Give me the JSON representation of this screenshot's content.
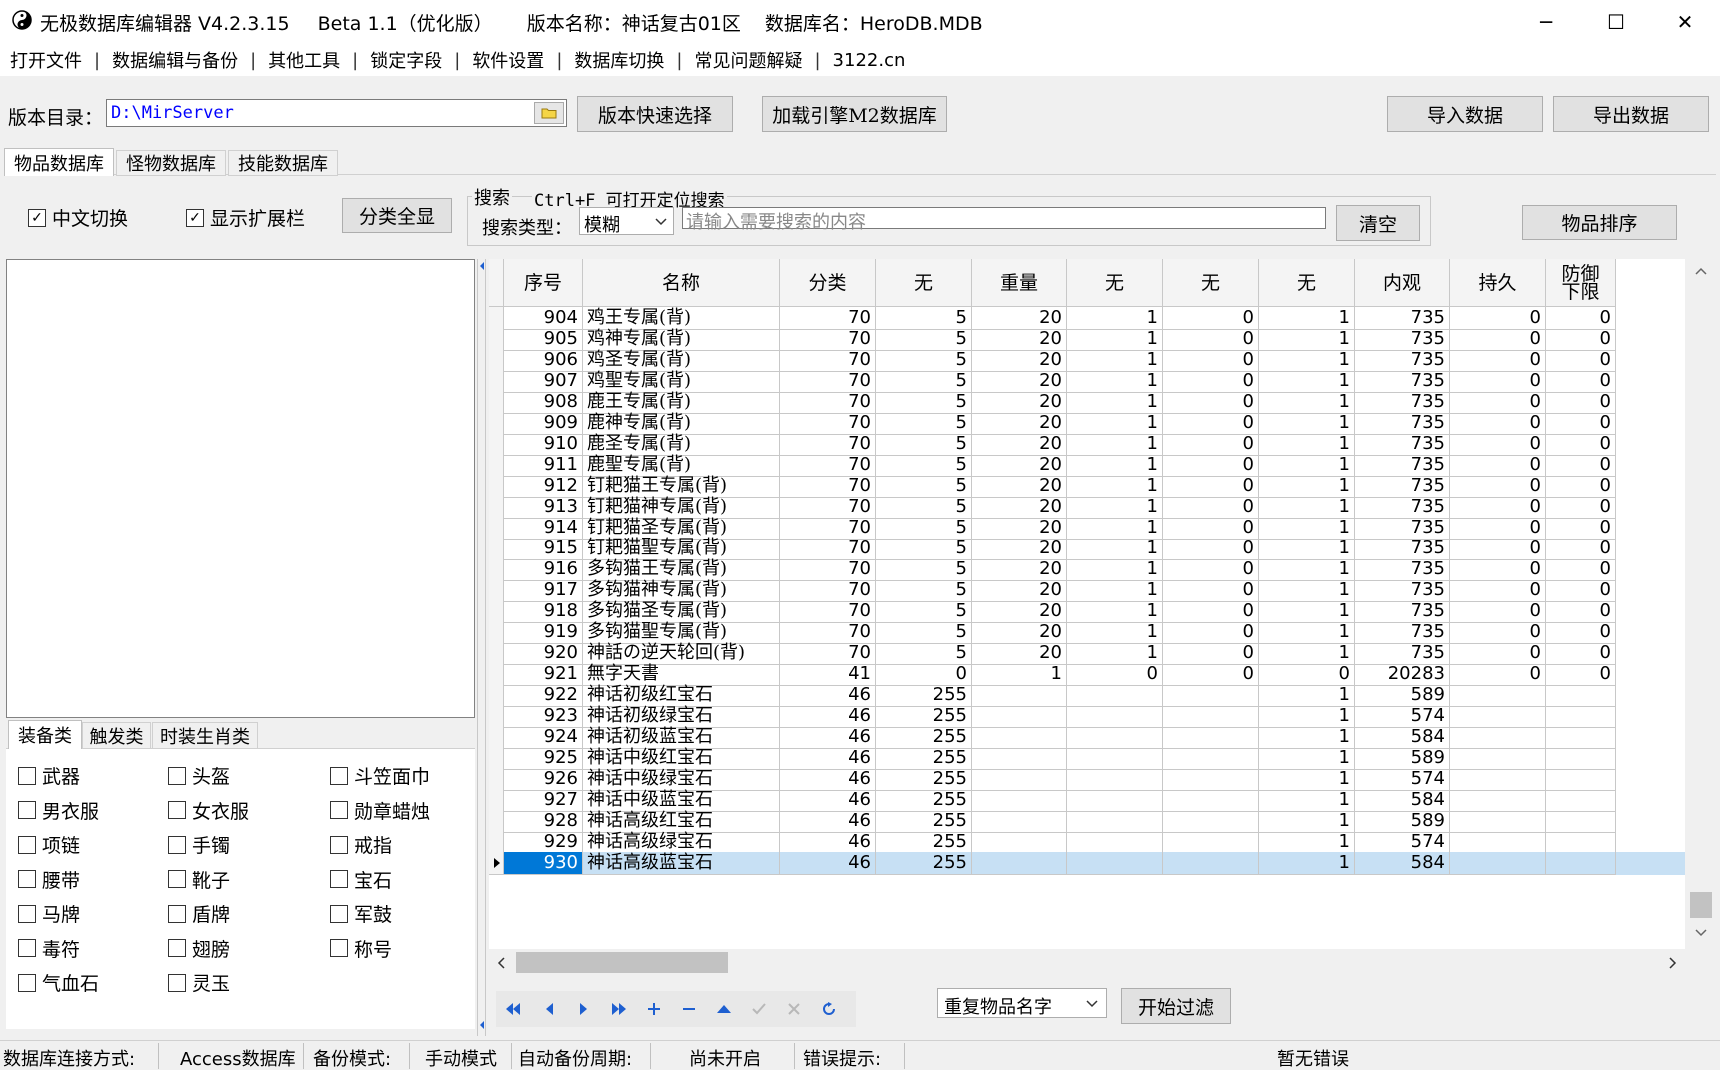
{
  "title": {
    "app": "无极数据库编辑器 V4.2.3.15",
    "beta": "Beta 1.1（优化版）",
    "version": "版本名称：神话复古01区",
    "db": "数据库名：HeroDB.MDB"
  },
  "window": {
    "minimize": "─",
    "maximize": "☐",
    "close": "✕"
  },
  "menu": [
    "打开文件",
    "数据编辑与备份",
    "其他工具",
    "锁定字段",
    "软件设置",
    "数据库切换",
    "常见问题解疑",
    "3122.cn"
  ],
  "toolbar": {
    "dir_label": "版本目录：",
    "dir_value": "D:\\MirServer",
    "quick_select": "版本快速选择",
    "load_m2": "加载引擎M2数据库",
    "import": "导入数据",
    "export": "导出数据"
  },
  "db_tabs": [
    "物品数据库",
    "怪物数据库",
    "技能数据库"
  ],
  "options": {
    "cn_switch": "中文切换",
    "show_ext": "显示扩展栏",
    "show_all_cat": "分类全显",
    "search_group": "搜索",
    "search_hint": "Ctrl+F 可打开定位搜索",
    "search_type_label": "搜索类型：",
    "search_type_value": "模糊",
    "search_placeholder": "请输入需要搜索的内容",
    "clear": "清空",
    "sort": "物品排序"
  },
  "cat_tabs": [
    "装备类",
    "触发类",
    "时装生肖类"
  ],
  "categories": [
    "武器",
    "头盔",
    "斗笠面巾",
    "男衣服",
    "女衣服",
    "勋章蜡烛",
    "项链",
    "手镯",
    "戒指",
    "腰带",
    "靴子",
    "宝石",
    "马牌",
    "盾牌",
    "军鼓",
    "毒符",
    "翅膀",
    "称号",
    "气血石",
    "灵玉"
  ],
  "columns": [
    "序号",
    "名称",
    "分类",
    "无",
    "重量",
    "无",
    "无",
    "无",
    "内观",
    "持久",
    "防御下限"
  ],
  "rows": [
    [
      "904",
      "鸡王专属(背)",
      "70",
      "5",
      "20",
      "1",
      "0",
      "1",
      "735",
      "0",
      "0"
    ],
    [
      "905",
      "鸡神专属(背)",
      "70",
      "5",
      "20",
      "1",
      "0",
      "1",
      "735",
      "0",
      "0"
    ],
    [
      "906",
      "鸡圣专属(背)",
      "70",
      "5",
      "20",
      "1",
      "0",
      "1",
      "735",
      "0",
      "0"
    ],
    [
      "907",
      "鸡聖专属(背)",
      "70",
      "5",
      "20",
      "1",
      "0",
      "1",
      "735",
      "0",
      "0"
    ],
    [
      "908",
      "鹿王专属(背)",
      "70",
      "5",
      "20",
      "1",
      "0",
      "1",
      "735",
      "0",
      "0"
    ],
    [
      "909",
      "鹿神专属(背)",
      "70",
      "5",
      "20",
      "1",
      "0",
      "1",
      "735",
      "0",
      "0"
    ],
    [
      "910",
      "鹿圣专属(背)",
      "70",
      "5",
      "20",
      "1",
      "0",
      "1",
      "735",
      "0",
      "0"
    ],
    [
      "911",
      "鹿聖专属(背)",
      "70",
      "5",
      "20",
      "1",
      "0",
      "1",
      "735",
      "0",
      "0"
    ],
    [
      "912",
      "钉耙猫王专属(背)",
      "70",
      "5",
      "20",
      "1",
      "0",
      "1",
      "735",
      "0",
      "0"
    ],
    [
      "913",
      "钉耙猫神专属(背)",
      "70",
      "5",
      "20",
      "1",
      "0",
      "1",
      "735",
      "0",
      "0"
    ],
    [
      "914",
      "钉耙猫圣专属(背)",
      "70",
      "5",
      "20",
      "1",
      "0",
      "1",
      "735",
      "0",
      "0"
    ],
    [
      "915",
      "钉耙猫聖专属(背)",
      "70",
      "5",
      "20",
      "1",
      "0",
      "1",
      "735",
      "0",
      "0"
    ],
    [
      "916",
      "多钩猫王专属(背)",
      "70",
      "5",
      "20",
      "1",
      "0",
      "1",
      "735",
      "0",
      "0"
    ],
    [
      "917",
      "多钩猫神专属(背)",
      "70",
      "5",
      "20",
      "1",
      "0",
      "1",
      "735",
      "0",
      "0"
    ],
    [
      "918",
      "多钩猫圣专属(背)",
      "70",
      "5",
      "20",
      "1",
      "0",
      "1",
      "735",
      "0",
      "0"
    ],
    [
      "919",
      "多钩猫聖专属(背)",
      "70",
      "5",
      "20",
      "1",
      "0",
      "1",
      "735",
      "0",
      "0"
    ],
    [
      "920",
      "神話の逆天轮回(背)",
      "70",
      "5",
      "20",
      "1",
      "0",
      "1",
      "735",
      "0",
      "0"
    ],
    [
      "921",
      "無字天書",
      "41",
      "0",
      "1",
      "0",
      "0",
      "0",
      "20283",
      "0",
      "0"
    ],
    [
      "922",
      "神话初级红宝石",
      "46",
      "255",
      "",
      "",
      "",
      "1",
      "589",
      "",
      ""
    ],
    [
      "923",
      "神话初级绿宝石",
      "46",
      "255",
      "",
      "",
      "",
      "1",
      "574",
      "",
      ""
    ],
    [
      "924",
      "神话初级蓝宝石",
      "46",
      "255",
      "",
      "",
      "",
      "1",
      "584",
      "",
      ""
    ],
    [
      "925",
      "神话中级红宝石",
      "46",
      "255",
      "",
      "",
      "",
      "1",
      "589",
      "",
      ""
    ],
    [
      "926",
      "神话中级绿宝石",
      "46",
      "255",
      "",
      "",
      "",
      "1",
      "574",
      "",
      ""
    ],
    [
      "927",
      "神话中级蓝宝石",
      "46",
      "255",
      "",
      "",
      "",
      "1",
      "584",
      "",
      ""
    ],
    [
      "928",
      "神话高级红宝石",
      "46",
      "255",
      "",
      "",
      "",
      "1",
      "589",
      "",
      ""
    ],
    [
      "929",
      "神话高级绿宝石",
      "46",
      "255",
      "",
      "",
      "",
      "1",
      "574",
      "",
      ""
    ],
    [
      "930",
      "神话高级蓝宝石",
      "46",
      "255",
      "",
      "",
      "",
      "1",
      "584",
      "",
      ""
    ]
  ],
  "selected_row": "930",
  "bottom": {
    "filter_type": "重复物品名字",
    "start_filter": "开始过滤"
  },
  "status": {
    "conn_label": "数据库连接方式:",
    "conn_value": "Access数据库",
    "backup_label": "备份模式:",
    "backup_value": "手动模式",
    "auto_label": "自动备份周期:",
    "auto_value": "尚未开启",
    "err_label": "错误提示:",
    "err_value": "暂无错误"
  },
  "colors": {
    "selection": "#c7e0f4",
    "selected_id_bg": "#0078d7",
    "link_text": "#0000ff",
    "nav_icon": "#1e5fd0"
  }
}
